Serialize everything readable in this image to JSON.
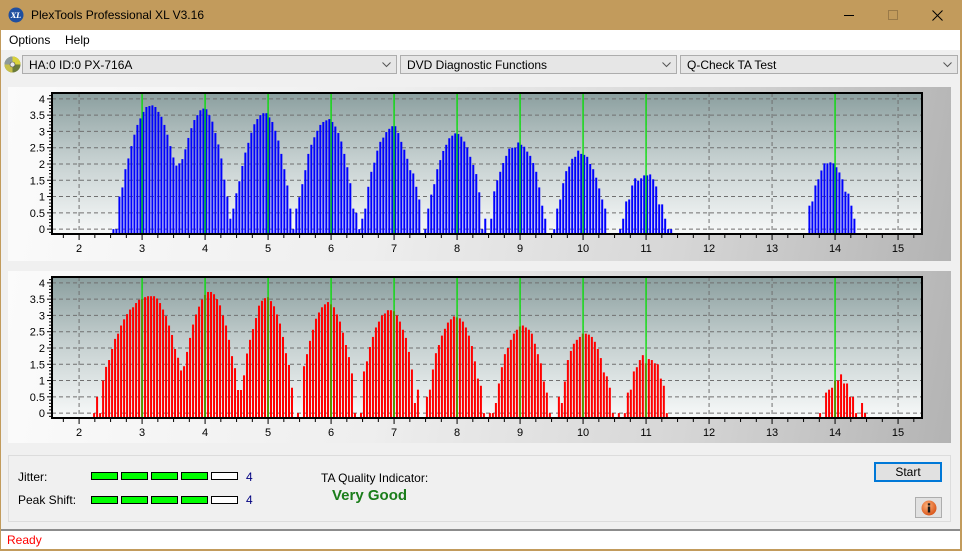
{
  "window": {
    "title": "PlexTools Professional XL V3.16",
    "app_icon": "xl-logo-icon",
    "app_icon_text": "XL",
    "controls": [
      "minimize",
      "maximize",
      "close"
    ]
  },
  "menu": [
    {
      "label": "Options"
    },
    {
      "label": "Help"
    }
  ],
  "toolbar": {
    "drive_icon": "disc-icon",
    "drive": "HA:0 ID:0  PX-716A",
    "function": "DVD Diagnostic Functions",
    "test": "Q-Check TA Test"
  },
  "chart_data": [
    {
      "type": "bar",
      "title": "",
      "xlabel": "",
      "ylabel": "",
      "xlim": [
        1.57,
        15.38
      ],
      "ylim": [
        -0.15,
        4.18
      ],
      "x_ticks": [
        2,
        3,
        4,
        5,
        6,
        7,
        8,
        9,
        10,
        11,
        12,
        13,
        14,
        15
      ],
      "y_ticks": [
        0,
        0.5,
        1,
        1.5,
        2,
        2.5,
        3,
        3.5,
        4
      ],
      "grid": true,
      "legend": "none",
      "reference_lines": [
        3,
        4,
        5,
        6,
        7,
        8,
        9,
        10,
        11,
        14
      ],
      "reference_color": "#00e000",
      "bar_step": 0.0476,
      "series": [
        {
          "name": "",
          "color": "#0000ff",
          "segments": [
            {
              "x0": 2.545,
              "values": [
                0,
                0,
                1.0,
                1.28,
                1.84,
                2.17,
                2.55,
                2.9,
                3.2,
                3.4,
                3.6,
                3.75,
                3.78,
                3.8,
                3.75,
                3.6,
                3.45,
                3.2,
                2.9,
                2.55,
                2.2,
                1.95,
                2.02,
                2.15,
                2.45,
                2.8,
                3.1,
                3.35,
                3.5,
                3.65,
                3.7,
                3.68,
                3.5,
                3.3,
                2.95,
                2.6,
                2.17,
                1.52,
                1.0,
                0.32,
                0.63,
                1.1,
                1.47,
                1.94,
                2.35,
                2.65,
                2.96,
                3.22,
                3.38,
                3.5,
                3.56,
                3.56,
                3.43,
                3.29,
                3.02,
                2.72,
                2.31,
                1.84,
                1.34,
                0.63,
                0,
                0.63,
                0.98,
                1.38,
                1.81,
                2.31,
                2.59,
                2.82,
                3.02,
                3.2,
                3.29,
                3.34,
                3.38,
                3.29,
                3.15,
                2.95,
                2.69,
                2.31,
                1.9,
                1.41,
                0.63,
                0.5,
                0,
                0.32,
                0.63,
                1.3,
                1.76,
                2.04,
                2.41,
                2.68,
                2.81,
                2.98,
                3.08,
                3.16,
                3.16,
                2.95,
                2.68,
                2.44,
                2.16,
                1.81,
                1.71,
                1.3,
                0.91,
                null,
                0,
                0.63,
                1.06,
                1.38,
                1.84,
                2.12,
                2.4,
                2.59,
                2.79,
                2.87,
                2.94,
                2.92,
                2.84,
                2.69,
                2.51,
                2.22,
                1.97,
                1.69,
                1.13,
                0,
                0.32,
                null,
                0.32,
                1.16,
                1.5,
                1.76,
                2.03,
                2.25,
                2.47,
                2.5,
                2.5,
                2.66,
                2.59,
                2.53,
                2.38,
                2.25,
                2.03,
                1.76,
                1.28,
                0.72,
                0.32,
                null,
                null,
                0,
                0.63,
                0.91,
                1.41,
                1.78,
                1.92,
                2.16,
                2.22,
                2.41,
                2.31,
                2.28,
                2.22,
                2.0,
                1.84,
                1.58,
                1.25,
                0.91,
                0.63,
                null,
                null,
                null,
                null,
                0,
                0.32,
                0.85,
                0.91,
                1.34,
                1.56,
                1.49,
                1.56,
                1.65,
                1.65,
                1.68,
                1.53,
                1.31,
                0.76,
                0.76,
                0.32,
                0,
                0
              ]
            },
            {
              "x0": 13.593,
              "values": [
                0.72,
                0.85,
                1.34,
                1.53,
                1.8,
                2.02,
                2.02,
                2.05,
                2.02,
                1.9,
                1.74,
                1.53,
                1.15,
                1.09,
                0.72,
                0.32
              ]
            }
          ]
        }
      ]
    },
    {
      "type": "bar",
      "title": "",
      "xlabel": "",
      "ylabel": "",
      "xlim": [
        1.57,
        15.38
      ],
      "ylim": [
        -0.15,
        4.18
      ],
      "x_ticks": [
        2,
        3,
        4,
        5,
        6,
        7,
        8,
        9,
        10,
        11,
        12,
        13,
        14,
        15
      ],
      "y_ticks": [
        0,
        0.5,
        1,
        1.5,
        2,
        2.5,
        3,
        3.5,
        4
      ],
      "grid": true,
      "legend": "none",
      "reference_lines": [
        3,
        4,
        5,
        6,
        7,
        8,
        9,
        10,
        11,
        14
      ],
      "reference_color": "#00e000",
      "bar_step": 0.0476,
      "series": [
        {
          "name": "",
          "color": "#ff0000",
          "segments": [
            {
              "x0": 2.238,
              "values": [
                0,
                0.5,
                0,
                1.0,
                1.42,
                1.63,
                1.97,
                2.28,
                2.44,
                2.69,
                2.88,
                3.04,
                3.18,
                3.25,
                3.38,
                3.48,
                3.5,
                3.56,
                3.59,
                3.59,
                3.59,
                3.52,
                3.38,
                3.18,
                2.98,
                2.69,
                2.4,
                1.97,
                1.7,
                1.31,
                1.44,
                1.88,
                2.31,
                2.72,
                3.03,
                3.27,
                3.49,
                3.63,
                3.72,
                3.72,
                3.65,
                3.5,
                3.31,
                3.0,
                2.69,
                2.25,
                1.75,
                1.38,
                0.71,
                0.71,
                1.16,
                1.83,
                2.25,
                2.58,
                2.92,
                3.3,
                3.45,
                3.53,
                3.56,
                3.44,
                3.28,
                3.03,
                2.75,
                2.34,
                1.84,
                1.48,
                0.78,
                null,
                0,
                null,
                1.44,
                1.81,
                2.22,
                2.56,
                2.9,
                3.09,
                3.25,
                3.34,
                3.41,
                3.34,
                3.25,
                3.03,
                2.81,
                2.47,
                2.09,
                1.72,
                1.22,
                0,
                null,
                0,
                1.28,
                1.59,
                2.03,
                2.34,
                2.63,
                2.81,
                3.0,
                3.06,
                3.16,
                3.16,
                3.13,
                3.0,
                2.81,
                2.56,
                2.31,
                1.88,
                1.34,
                0.31,
                0.72,
                null,
                null,
                0.5,
                0.72,
                1.34,
                1.84,
                2.09,
                2.38,
                2.59,
                2.78,
                2.88,
                2.97,
                2.94,
                2.91,
                2.81,
                2.63,
                2.38,
                2.06,
                1.59,
                1.06,
                0.84,
                0,
                null,
                0,
                0,
                0.31,
                0.91,
                1.41,
                1.81,
                2.0,
                2.25,
                2.44,
                2.56,
                2.66,
                2.69,
                2.63,
                2.56,
                2.44,
                2.13,
                1.81,
                1.53,
                0.97,
                0.63,
                0,
                null,
                null,
                0.5,
                0.31,
                0.97,
                1.63,
                1.91,
                2.13,
                2.25,
                2.34,
                2.44,
                2.44,
                2.41,
                2.34,
                2.19,
                1.97,
                1.69,
                1.25,
                1.13,
                0.78,
                0,
                null,
                0,
                null,
                0,
                0.63,
                0.72,
                1.28,
                1.41,
                1.63,
                1.78,
                1.53,
                1.66,
                1.63,
                1.53,
                1.5,
                1.06,
                0.84,
                0
              ]
            },
            {
              "x0": 13.762,
              "values": [
                0,
                null,
                0.63,
                0.72,
                0.78,
                1.0,
                1.0,
                1.19,
                0.91,
                0.91,
                0.5,
                0.5,
                0,
                null,
                0.31,
                0
              ]
            }
          ]
        }
      ]
    }
  ],
  "results": {
    "jitter": {
      "label": "Jitter:",
      "level": 4,
      "max": 5,
      "value_text": "4"
    },
    "peak_shift": {
      "label": "Peak Shift:",
      "level": 4,
      "max": 5,
      "value_text": "4"
    },
    "meter_fill_color": "#00ff00",
    "ta_quality": {
      "label": "TA Quality Indicator:",
      "value": "Very Good",
      "color": "#1a7d1a"
    }
  },
  "buttons": {
    "start": "Start",
    "info_icon": "info-icon"
  },
  "status": {
    "text": "Ready",
    "color": "#ff0000"
  }
}
